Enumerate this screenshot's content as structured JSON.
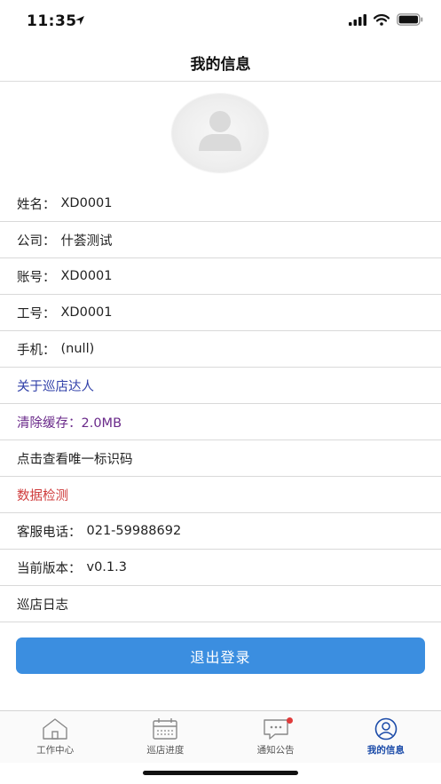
{
  "status_bar": {
    "time": "11:35"
  },
  "header": {
    "title": "我的信息"
  },
  "profile": {
    "rows": [
      {
        "key": "name",
        "label": "姓名：",
        "value": "XD0001"
      },
      {
        "key": "company",
        "label": "公司：",
        "value": "什荟测试"
      },
      {
        "key": "account",
        "label": "账号：",
        "value": "XD0001"
      },
      {
        "key": "job-number",
        "label": "工号：",
        "value": "XD0001"
      },
      {
        "key": "phone",
        "label": "手机：",
        "value": "(null)"
      }
    ],
    "about": "关于巡店达人",
    "clear_cache": "清除缓存：2.0MB",
    "device_id": "点击查看唯一标识码",
    "data_check": "数据检测",
    "service_phone": {
      "label": "客服电话：",
      "value": "021-59988692"
    },
    "version": {
      "label": "当前版本：",
      "value": "v0.1.3"
    },
    "inspection_log": "巡店日志"
  },
  "actions": {
    "logout_label": "退出登录"
  },
  "tab_bar": {
    "tabs": [
      {
        "label": "工作中心",
        "icon": "home-icon"
      },
      {
        "label": "巡店进度",
        "icon": "calendar-icon"
      },
      {
        "label": "通知公告",
        "icon": "message-icon"
      },
      {
        "label": "我的信息",
        "icon": "user-icon"
      }
    ],
    "active_index": 3
  },
  "colors": {
    "accent": "#3b8ee0",
    "tab_active": "#1a4aa8",
    "link_blue": "#2f3fa8",
    "cache_purple": "#6a2a8a",
    "alert_red": "#cf3c3c",
    "badge": "#e03b3b"
  }
}
